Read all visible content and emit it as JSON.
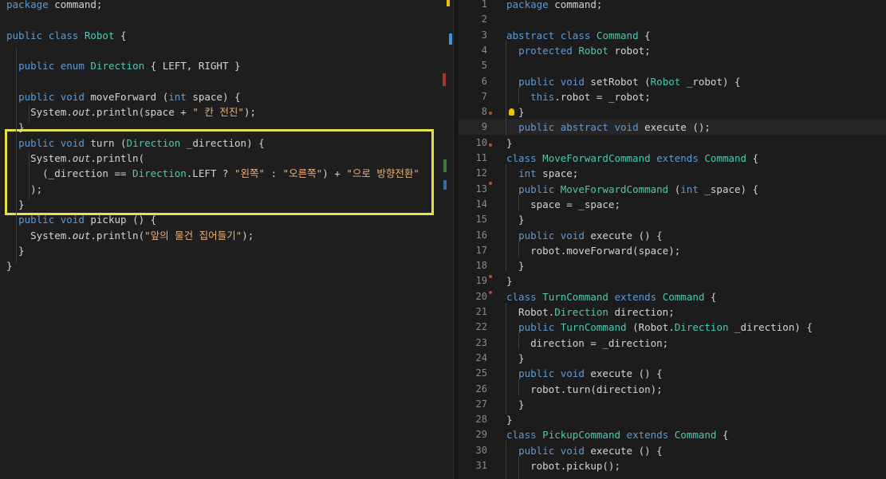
{
  "left_code": [
    {
      "text": "package command;"
    },
    {
      "text": ""
    },
    {
      "text": "public class Robot {"
    },
    {
      "text": ""
    },
    {
      "text": "  public enum Direction { LEFT, RIGHT }"
    },
    {
      "text": ""
    },
    {
      "text": "  public void moveForward (int space) {"
    },
    {
      "text": "    System.out.println(space + \" 칸 전진\");"
    },
    {
      "text": "  }"
    },
    {
      "text": "  public void turn (Direction _direction) {"
    },
    {
      "text": "    System.out.println("
    },
    {
      "text": "      (_direction == Direction.LEFT ? \"왼쪽\" : \"오른쪽\") + \"으로 방향전환\""
    },
    {
      "text": "    );"
    },
    {
      "text": "  }"
    },
    {
      "text": "  public void pickup () {"
    },
    {
      "text": "    System.out.println(\"앞의 물건 집어들기\");"
    },
    {
      "text": "  }"
    },
    {
      "text": "}"
    }
  ],
  "right_code": [
    {
      "num": "1",
      "text": "package command;"
    },
    {
      "num": "2",
      "text": ""
    },
    {
      "num": "3",
      "text": "abstract class Command {"
    },
    {
      "num": "4",
      "text": "  protected Robot robot;"
    },
    {
      "num": "5",
      "text": ""
    },
    {
      "num": "6",
      "text": "  public void setRobot (Robot _robot) {"
    },
    {
      "num": "7",
      "text": "    this.robot = _robot;"
    },
    {
      "num": "8",
      "text": "  }"
    },
    {
      "num": "9",
      "text": "  public abstract void execute ();"
    },
    {
      "num": "10",
      "text": "}"
    },
    {
      "num": "11",
      "text": "class MoveForwardCommand extends Command {"
    },
    {
      "num": "12",
      "text": "  int space;"
    },
    {
      "num": "13",
      "text": "  public MoveForwardCommand (int _space) {"
    },
    {
      "num": "14",
      "text": "    space = _space;"
    },
    {
      "num": "15",
      "text": "  }"
    },
    {
      "num": "16",
      "text": "  public void execute () {"
    },
    {
      "num": "17",
      "text": "    robot.moveForward(space);"
    },
    {
      "num": "18",
      "text": "  }"
    },
    {
      "num": "19",
      "text": "}"
    },
    {
      "num": "20",
      "text": "class TurnCommand extends Command {"
    },
    {
      "num": "21",
      "text": "  Robot.Direction direction;"
    },
    {
      "num": "22",
      "text": "  public TurnCommand (Robot.Direction _direction) {"
    },
    {
      "num": "23",
      "text": "    direction = _direction;"
    },
    {
      "num": "24",
      "text": "  }"
    },
    {
      "num": "25",
      "text": "  public void execute () {"
    },
    {
      "num": "26",
      "text": "    robot.turn(direction);"
    },
    {
      "num": "27",
      "text": "  }"
    },
    {
      "num": "28",
      "text": "}"
    },
    {
      "num": "29",
      "text": "class PickupCommand extends Command {"
    },
    {
      "num": "30",
      "text": "  public void execute () {"
    },
    {
      "num": "31",
      "text": "    robot.pickup();"
    }
  ],
  "colors": {
    "keyword": "#5c9bd6",
    "type": "#4ec9b0",
    "string": "#e8b27a",
    "highlight_box": "#e6e14a",
    "background": "#1e1e1e"
  }
}
